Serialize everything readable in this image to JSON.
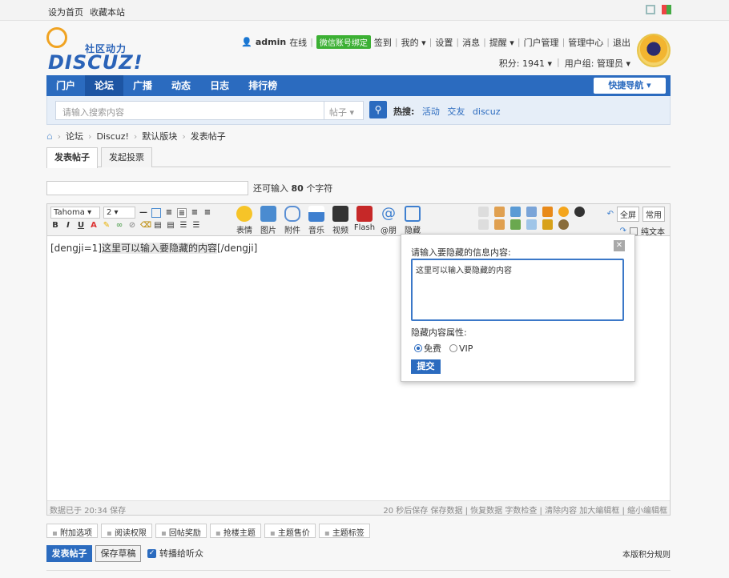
{
  "topbar": {
    "home_link": "设为首页",
    "bookmark_link": "收藏本站"
  },
  "header": {
    "logo_sub": "社区动力",
    "logo_main": "DISCUZ!",
    "username": "admin",
    "online": "在线",
    "wechat_bind": "微信账号绑定",
    "menu": [
      "签到",
      "我的",
      "设置",
      "消息",
      "提醒",
      "门户管理",
      "管理中心",
      "退出"
    ],
    "points": "积分: 1941",
    "usergroup": "用户组: 管理员"
  },
  "nav": {
    "items": [
      "门户",
      "论坛",
      "广播",
      "动态",
      "日志",
      "排行榜"
    ],
    "active": "论坛",
    "quick": "快捷导航"
  },
  "search": {
    "placeholder": "请输入搜索内容",
    "type": "帖子",
    "hot_label": "热搜:",
    "hot": [
      "活动",
      "交友",
      "discuz"
    ]
  },
  "breadcrumb": [
    "论坛",
    "Discuz!",
    "默认版块",
    "发表帖子"
  ],
  "tabs": [
    "发表帖子",
    "发起投票"
  ],
  "subject": {
    "hint_prefix": "还可输入",
    "count": "80",
    "hint_suffix": "个字符"
  },
  "editor": {
    "font": "Tahoma",
    "size": "2",
    "big_buttons": [
      "表情",
      "图片",
      "附件",
      "音乐",
      "视频",
      "Flash",
      "@朋",
      "隐藏"
    ],
    "fullscreen": "全屏",
    "common": "常用",
    "plaintext": "纯文本",
    "content_prefix": "[dengji=1]",
    "content_mid": "这里可以输入要隐藏的内容",
    "content_suffix": "[/dengji]",
    "footer_left": "数据已于 20:34 保存",
    "footer_right": "20 秒后保存 保存数据 | 恢复数据    字数检查 | 清除内容    加大编辑框 | 缩小编辑框"
  },
  "popup": {
    "title": "请输入要隐藏的信息内容:",
    "textarea": "这里可以输入要隐藏的内容",
    "attr_label": "隐藏内容属性:",
    "option_free": "免费",
    "option_vip": "VIP",
    "submit": "提交"
  },
  "options": [
    "附加选项",
    "阅读权限",
    "回帖奖励",
    "抢楼主题",
    "主题售价",
    "主题标签"
  ],
  "actions": {
    "post": "发表帖子",
    "draft": "保存草稿",
    "broadcast": "转播给听众",
    "rules": "本版积分规则"
  },
  "colors": {
    "brand_blue": "#2b6bbf",
    "nav_active": "#1d55a3",
    "wechat_green": "#3cb034"
  }
}
